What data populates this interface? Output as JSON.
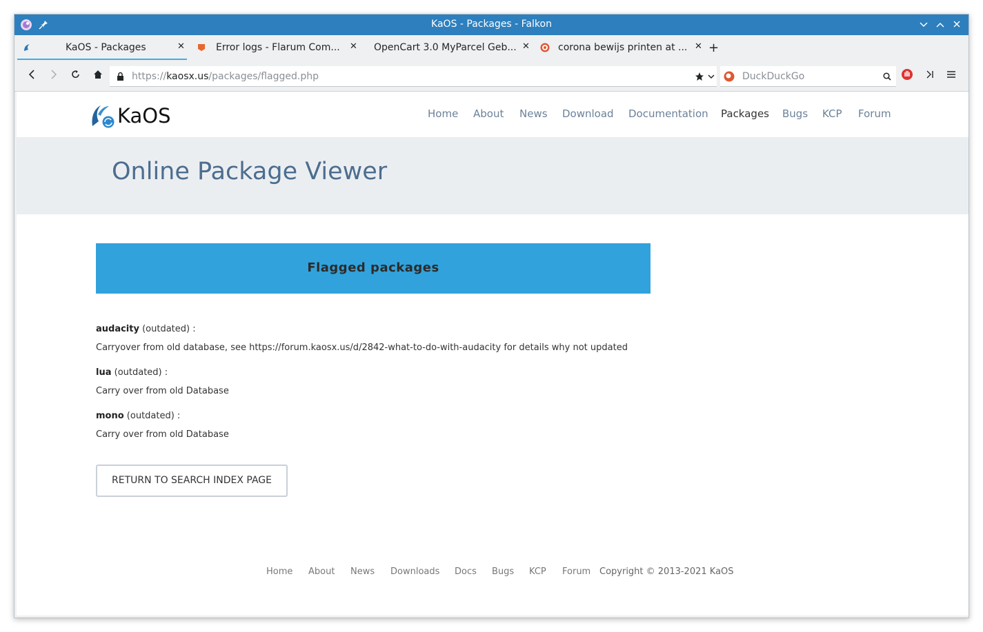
{
  "window": {
    "title": "KaOS - Packages - Falkon"
  },
  "tabs": [
    {
      "label": "KaOS - Packages",
      "active": true,
      "icon": "kaos-icon"
    },
    {
      "label": "Error logs - Flarum Com...",
      "active": false,
      "icon": "flarum-icon"
    },
    {
      "label": "OpenCart 3.0 MyParcel Geb...",
      "active": false,
      "icon": ""
    },
    {
      "label": "corona bewijs printen at ...",
      "active": false,
      "icon": "duckduckgo-icon"
    }
  ],
  "urlbar": {
    "prefix": "https://",
    "host": "kaosx.us",
    "path": "/packages/flagged.php"
  },
  "searchbar": {
    "placeholder": "DuckDuckGo"
  },
  "site": {
    "logo": "KaOS",
    "menu": [
      "Home",
      "About",
      "News",
      "Download",
      "Documentation",
      "Packages",
      "Bugs",
      "KCP",
      "Forum"
    ],
    "active_menu": "Packages",
    "hero_title": "Online Package Viewer",
    "flag_title": "Flagged packages",
    "packages": [
      {
        "name": "audacity",
        "status": " (outdated) :",
        "desc": "Carryover from old database, see https://forum.kaosx.us/d/2842-what-to-do-with-audacity for details why not updated"
      },
      {
        "name": "lua",
        "status": " (outdated) :",
        "desc": "Carry over from old Database"
      },
      {
        "name": "mono",
        "status": " (outdated) :",
        "desc": "Carry over from old Database"
      }
    ],
    "return_button": "RETURN TO SEARCH INDEX PAGE",
    "footer_links": [
      "Home",
      "About",
      "News",
      "Downloads",
      "Docs",
      "Bugs",
      "KCP",
      "Forum"
    ],
    "copyright": "Copyright © 2013-2021 KaOS"
  },
  "colors": {
    "titlebar": "#2d7fbd",
    "accent": "#31a2db",
    "hero_bg": "#ebeef1",
    "hero_text": "#4c6d8f"
  }
}
